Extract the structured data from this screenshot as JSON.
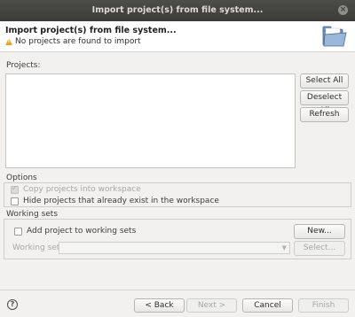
{
  "window": {
    "title": "Import project(s) from file system..."
  },
  "header": {
    "title": "Import project(s) from file system...",
    "message": "No projects are found to import"
  },
  "projects": {
    "label": "Projects:",
    "select_all": "Select All",
    "deselect_all": "Deselect All",
    "refresh": "Refresh"
  },
  "options": {
    "label": "Options",
    "copy_projects": "Copy projects into workspace",
    "hide_existing": "Hide projects that already exist in the workspace"
  },
  "working_sets": {
    "label": "Working sets",
    "add_to_sets": "Add project to working sets",
    "new_button": "New...",
    "sets_label": "Working sets:",
    "select_button": "Select..."
  },
  "footer": {
    "back": "< Back",
    "next": "Next >",
    "cancel": "Cancel",
    "finish": "Finish"
  },
  "icons": [
    "close-icon",
    "warning-icon",
    "folder-icon",
    "help-icon",
    "chevron-down-icon"
  ]
}
